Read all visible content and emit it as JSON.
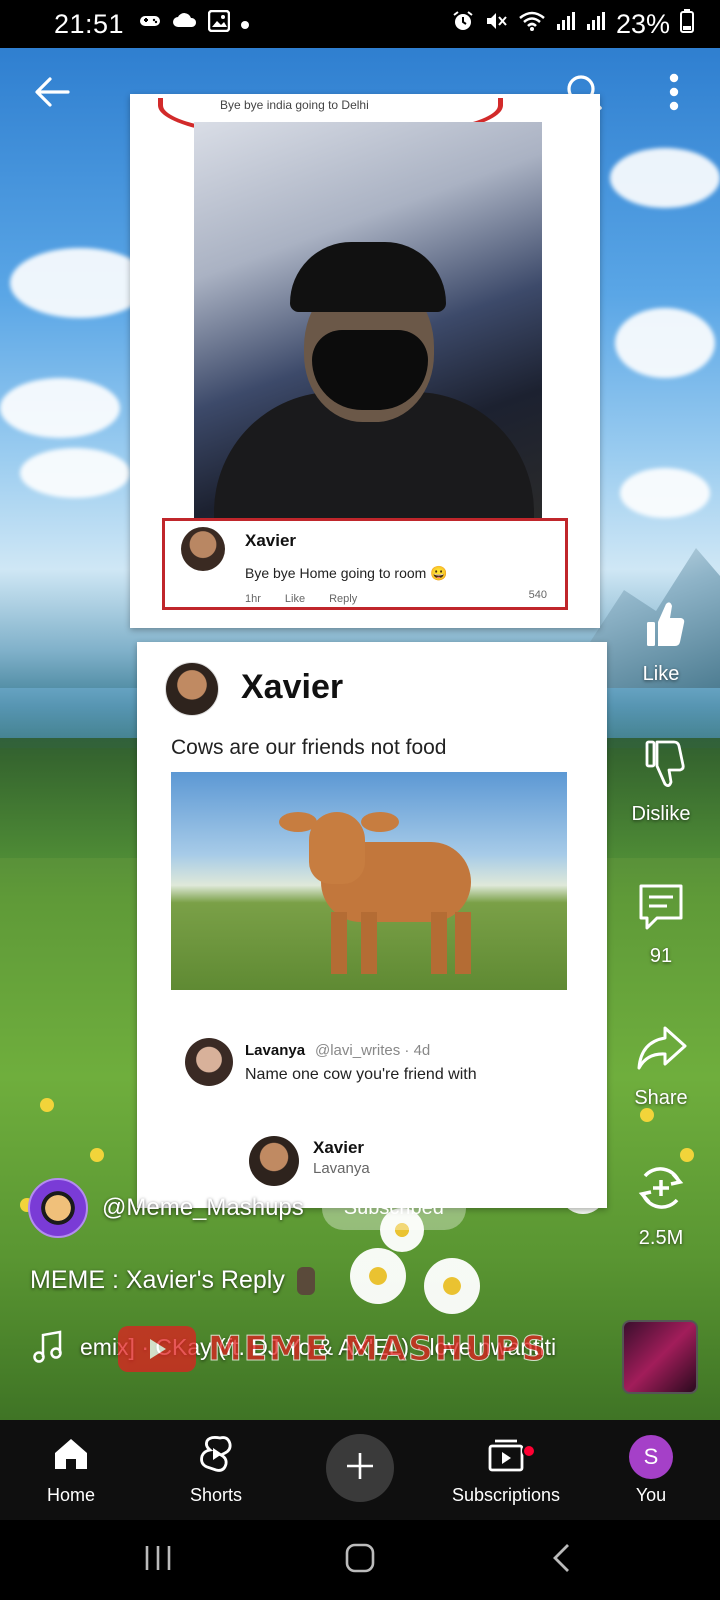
{
  "status_bar": {
    "time": "21:51",
    "battery": "23%",
    "left_icons": [
      "game-controller-icon",
      "cloud-icon",
      "image-icon",
      "dot-icon"
    ],
    "right_icons": [
      "alarm-icon",
      "mute-icon",
      "wifi-icon",
      "signal-icon",
      "signal-icon",
      "battery-icon"
    ]
  },
  "top_controls": {
    "back_icon": "back-arrow-icon",
    "search_icon": "search-icon",
    "more_icon": "more-vertical-icon"
  },
  "meme_top": {
    "caption": "Bye bye india going to Delhi",
    "comment": {
      "name": "Xavier",
      "text": "Bye bye Home going to room 😀",
      "time": "1hr",
      "like": "Like",
      "reply": "Reply",
      "reactions": "540"
    }
  },
  "meme_bottom": {
    "name": "Xavier",
    "post_text": "Cows are our friends not food",
    "reply1": {
      "name": "Lavanya",
      "handle": "@lavi_writes · 4d",
      "text": "Name one cow you're friend with"
    },
    "reply2": {
      "name": "Xavier",
      "sub": "Lavanya"
    }
  },
  "actions": {
    "like": {
      "label": "Like",
      "icon": "thumbs-up-icon"
    },
    "dislike": {
      "label": "Dislike",
      "icon": "thumbs-down-icon"
    },
    "comments": {
      "label": "91",
      "icon": "comment-icon"
    },
    "share": {
      "label": "Share",
      "icon": "share-icon"
    },
    "remix": {
      "label": "2.5M",
      "icon": "remix-icon"
    }
  },
  "channel": {
    "name": "@Meme_Mashups",
    "subscribe_label": "Subscribed"
  },
  "video": {
    "title": "MEME : Xavier's Reply",
    "music_text": "emix] · CKay (ft. DJ Yo & AX'EL) · love nwantiti",
    "watermark": "MEME MASHUPS"
  },
  "bottom_nav": {
    "home": "Home",
    "shorts": "Shorts",
    "subscriptions": "Subscriptions",
    "you": "You",
    "you_initial": "S"
  },
  "colors": {
    "accent_red": "#ff0033",
    "avatar_purple": "#a540c8",
    "nav_bg": "#0f0f0f"
  }
}
